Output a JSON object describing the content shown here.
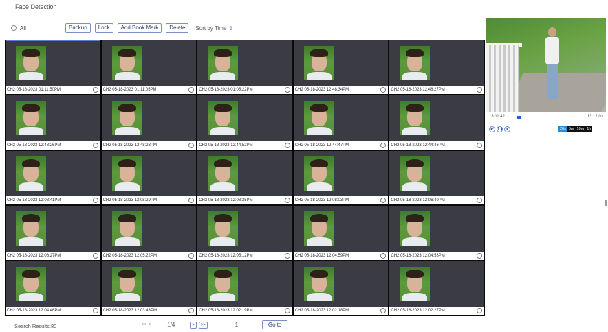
{
  "page": {
    "title": "Face Detection"
  },
  "toolbar": {
    "all_label": "All",
    "backup": "Backup",
    "lock": "Lock",
    "add_bookmark": "Add Book Mark",
    "delete": "Delete",
    "sort": "Sort by Time",
    "sort_icon": "sort-updown-icon"
  },
  "results": [
    "CH2 05-18-2023 01:11:50PM",
    "CH2 05-18-2023 01:11:05PM",
    "CH2 05-18-2023 01:05:22PM",
    "CH2 05-18-2023 12:48:34PM",
    "CH2 05-18-2023 12:48:27PM",
    "CH2 05-18-2023 12:48:26PM",
    "CH2 05-18-2023 12:48:23PM",
    "CH2 05-18-2023 12:44:52PM",
    "CH2 05-18-2023 12:44:47PM",
    "CH2 05-18-2023 12:44:46PM",
    "CH2 05-18-2023 12:08:41PM",
    "CH2 05-18-2023 12:08:29PM",
    "CH2 05-18-2023 12:08:35PM",
    "CH2 05-18-2023 12:08:03PM",
    "CH2 05-18-2023 12:06:49PM",
    "CH2 05-18-2023 12:06:27PM",
    "CH2 05-18-2023 12:05:22PM",
    "CH2 05-18-2023 12:05:12PM",
    "CH2 05-18-2023 12:04:59PM",
    "CH2 05-18-2023 12:04:53PM",
    "CH2 05-18-2023 12:04:46PM",
    "CH2 05-18-2023 12:03:43PM",
    "CH2 05-18-2023 12:02:19PM",
    "CH2 05-18-2023 12:02:18PM",
    "CH2 05-18-2023 12:02:27PM"
  ],
  "preview": {
    "time_start": "13:11:42",
    "time_end": "13:12:03",
    "controls": [
      "play-icon",
      "pause-icon",
      "stop-icon"
    ],
    "speeds": [
      "20s",
      "5m",
      "10m",
      "1h"
    ]
  },
  "footer": {
    "search_results": "Search Results:80",
    "first_prev": "<< <",
    "page_count": "1/4",
    "next": ">",
    "last": ">>",
    "page_input": "1",
    "goto": "Go to"
  },
  "colors": {
    "grid_bg": "#0a0a0a",
    "cell_bg": "#3a3b43",
    "accent": "#1f8ee0"
  }
}
